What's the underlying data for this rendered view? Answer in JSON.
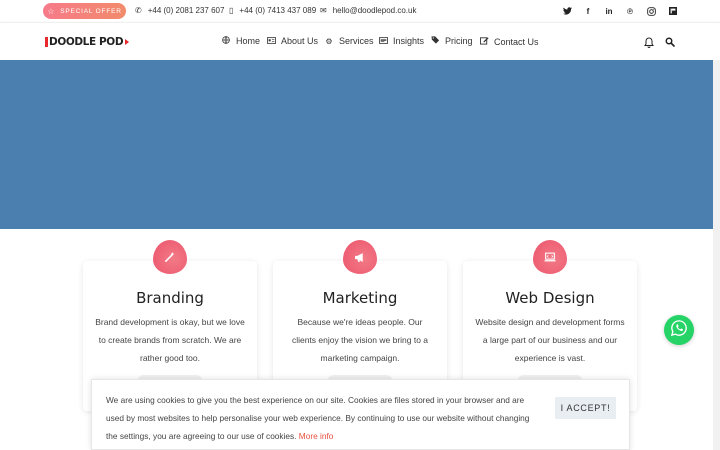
{
  "topbar": {
    "offer_label": "SPECIAL OFFER",
    "phone1": "+44 (0) 2081 237 607",
    "phone2": "+44 (0) 7413 437 089",
    "email": "hello@doodlepod.co.uk",
    "social_icons": [
      "twitter-icon",
      "facebook-icon",
      "linkedin-icon",
      "pinterest-icon",
      "instagram-icon",
      "flipboard-icon"
    ]
  },
  "nav": {
    "logo_text": "DOODLE POD",
    "items": [
      {
        "label": "Home",
        "icon": "globe-icon"
      },
      {
        "label": "About Us",
        "icon": "id-card-icon"
      },
      {
        "label": "Services",
        "icon": "cogs-icon"
      },
      {
        "label": "Insights",
        "icon": "newspaper-icon"
      },
      {
        "label": "Pricing",
        "icon": "tags-icon"
      },
      {
        "label": "Contact Us",
        "icon": "edit-icon"
      }
    ]
  },
  "hero": {
    "color": "#4a7fb0"
  },
  "services": [
    {
      "title": "Branding",
      "text": "Brand development is okay, but we love to create brands from scratch. We are rather good too.",
      "icon": "magic-wand-icon"
    },
    {
      "title": "Marketing",
      "text": "Because we're ideas people. Our clients enjoy the vision we bring to a marketing campaign.",
      "icon": "megaphone-icon"
    },
    {
      "title": "Web Design",
      "text": "Website design and development forms a large part of our business and our experience is vast.",
      "icon": "laptop-icon"
    }
  ],
  "cookie": {
    "text": "We are using cookies to give you the best experience on our site. Cookies are files stored in your browser and are used by most websites to help personalise your web experience. By continuing to use our website without changing the settings, you are agreeing to our use of cookies.",
    "more_label": "More info",
    "accept_label": "I ACCEPT!"
  },
  "colors": {
    "accent": "#ee5f74",
    "link": "#e8503f",
    "whatsapp": "#25d366"
  }
}
